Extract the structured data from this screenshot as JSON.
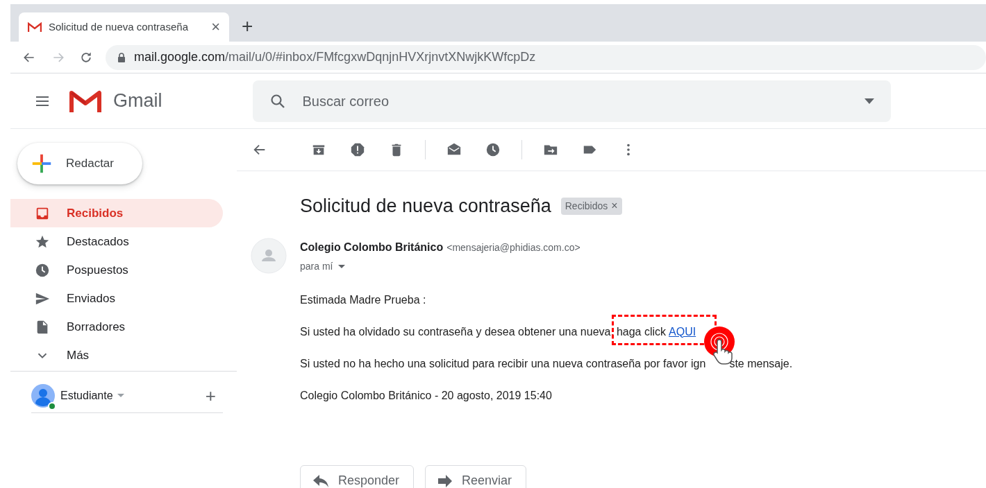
{
  "browser": {
    "tab": {
      "title": "Solicitud de nueva contraseña",
      "close": "×"
    },
    "new_tab": "+",
    "url": {
      "host": "mail.google.com",
      "path": "/mail/u/0/#inbox/FMfcgxwDqnjnHVXrjnvtXNwjkKWfcpDz"
    }
  },
  "header": {
    "brand": "Gmail",
    "search": {
      "placeholder": "Buscar correo"
    }
  },
  "sidebar": {
    "compose": "Redactar",
    "items": [
      {
        "label": "Recibidos",
        "selected": true
      },
      {
        "label": "Destacados",
        "selected": false
      },
      {
        "label": "Pospuestos",
        "selected": false
      },
      {
        "label": "Enviados",
        "selected": false
      },
      {
        "label": "Borradores",
        "selected": false
      },
      {
        "label": "Más",
        "selected": false
      }
    ],
    "account": {
      "name": "Estudiante",
      "online": true
    },
    "add": "+"
  },
  "message": {
    "subject": "Solicitud de nueva contraseña",
    "label": {
      "text": "Recibidos",
      "remove": "×"
    },
    "sender": {
      "name": "Colegio Colombo Británico",
      "email": "<mensajeria@phidias.com.co>",
      "recipient": "para mí"
    },
    "body": [
      {
        "kind": "text",
        "text": "Estimada Madre Prueba :"
      },
      {
        "kind": "link",
        "text": "Si usted ha olvidado su contraseña y desea obtener una nueva,",
        "highlight": "haga click",
        "link": "AQUI"
      },
      {
        "kind": "covered",
        "before": "Si usted no ha hecho una solicitud para recibir una nueva contraseña por favor ign",
        "after": "ste mensaje."
      },
      {
        "kind": "text",
        "text": "Colegio Colombo Británico - 20 agosto, 2019 15:40"
      }
    ],
    "actions": [
      "Responder",
      "Reenviar"
    ]
  }
}
